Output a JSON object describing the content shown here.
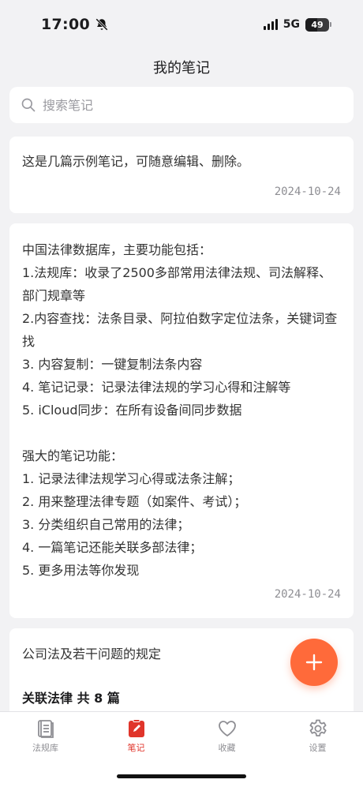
{
  "status_bar": {
    "time": "17:00",
    "network": "5G",
    "battery": "49"
  },
  "nav": {
    "title": "我的笔记"
  },
  "search": {
    "placeholder": "搜索笔记"
  },
  "notes": [
    {
      "text": "这是几篇示例笔记，可随意编辑、删除。",
      "date": "2024-10-24"
    },
    {
      "text": "中国法律数据库，主要功能包括：\n1.法规库：收录了2500多部常用法律法规、司法解释、部门规章等\n2.内容查找：法条目录、阿拉伯数字定位法条，关键词查找\n3. 内容复制：一键复制法条内容\n4. 笔记记录：记录法律法规的学习心得和注解等\n5. iCloud同步：在所有设备间同步数据\n\n强大的笔记功能：\n1. 记录法律法规学习心得或法条注解；\n2. 用来整理法律专题（如案件、考试）；\n3. 分类组织自己常用的法律；\n4. 一篇笔记还能关联多部法律；\n5. 更多用法等你发现",
      "date": "2024-10-24"
    },
    {
      "text": "公司法及若干问题的规定",
      "related": "关联法律 共 8 篇"
    }
  ],
  "tabs": [
    {
      "label": "法规库",
      "icon": "book-list-icon",
      "active": false
    },
    {
      "label": "笔记",
      "icon": "note-edit-icon",
      "active": true
    },
    {
      "label": "收藏",
      "icon": "heart-icon",
      "active": false
    },
    {
      "label": "设置",
      "icon": "gear-icon",
      "active": false
    }
  ],
  "colors": {
    "accent": "#e0352b",
    "fab": "#ff6a3a",
    "background": "#f2f2f4"
  }
}
